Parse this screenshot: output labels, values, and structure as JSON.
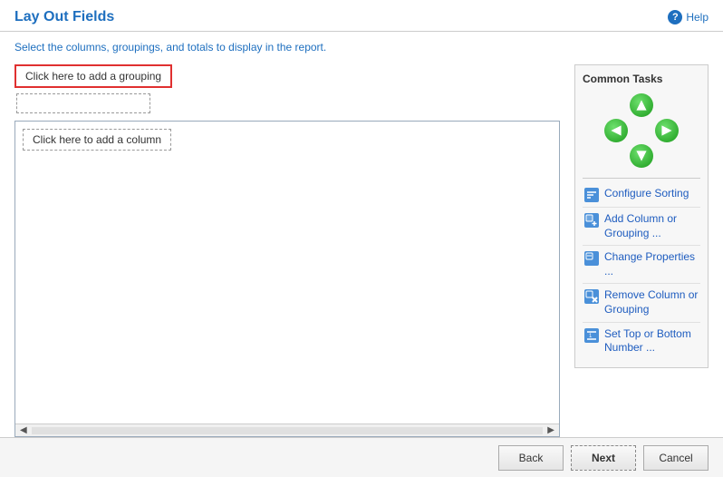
{
  "header": {
    "title": "Lay Out Fields",
    "help_label": "Help"
  },
  "subtitle": {
    "text_before": "Select the columns, groupings, and totals to ",
    "highlight": "display",
    "text_after": " in the report."
  },
  "grouping": {
    "add_label": "Click here to add a grouping"
  },
  "column": {
    "add_label": "Click here to add a column"
  },
  "common_tasks": {
    "title": "Common Tasks",
    "items": [
      {
        "id": "configure-sorting",
        "label": "Configure Sorting"
      },
      {
        "id": "add-column-grouping",
        "label": "Add Column or\nGrouping ..."
      },
      {
        "id": "change-properties",
        "label": "Change Properties ..."
      },
      {
        "id": "remove-column-grouping",
        "label": "Remove Column or\nGrouping"
      },
      {
        "id": "set-top-bottom",
        "label": "Set Top or Bottom\nNumber ..."
      }
    ]
  },
  "footer": {
    "back_label": "Back",
    "next_label": "Next",
    "cancel_label": "Cancel"
  }
}
